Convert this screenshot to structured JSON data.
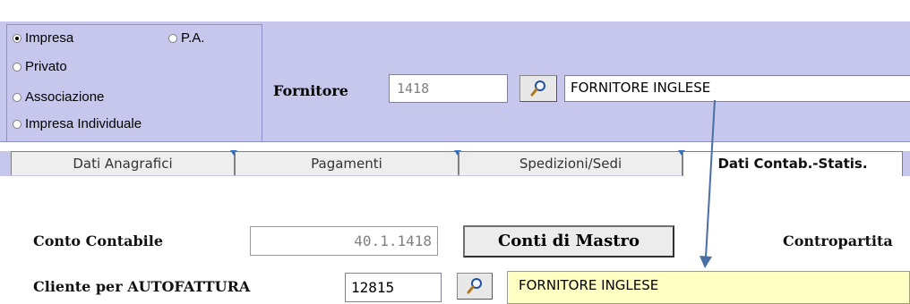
{
  "entity_types": {
    "options": [
      {
        "label": "Impresa",
        "selected": true
      },
      {
        "label": "P.A.",
        "selected": false
      },
      {
        "label": "Privato",
        "selected": false
      },
      {
        "label": "Associazione",
        "selected": false
      },
      {
        "label": "Impresa Individuale",
        "selected": false
      }
    ]
  },
  "supplier": {
    "label": "Fornitore",
    "code": "1418",
    "name": "FORNITORE INGLESE",
    "lookup_icon": "magnifier-icon"
  },
  "tabs": [
    {
      "label": "Dati Anagrafici",
      "active": false
    },
    {
      "label": "Pagamenti",
      "active": false
    },
    {
      "label": "Spedizioni/Sedi",
      "active": false
    },
    {
      "label": "Dati Contab.-Statis.",
      "active": true
    }
  ],
  "accounting": {
    "conto_label": "Conto Contabile",
    "conto_value": "40.1.1418",
    "mastro_button": "Conti di Mastro",
    "contropartita_label": "Contropartita",
    "cliente_label": "Cliente per AUTOFATTURA",
    "cliente_code": "12815",
    "cliente_name": "FORNITORE INGLESE"
  },
  "colors": {
    "header_bg": "#c7c7ee",
    "highlight_field": "#ffffc4",
    "arrow": "#4a6fa5"
  }
}
